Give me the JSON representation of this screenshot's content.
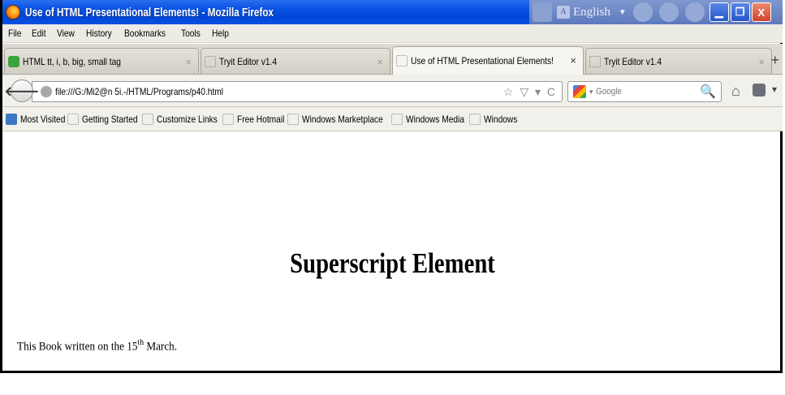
{
  "window": {
    "title": "Use of HTML Presentational Elements! - Mozilla Firefox",
    "language": "English",
    "controls": [
      "minimize",
      "restore",
      "close"
    ]
  },
  "menu": [
    "File",
    "Edit",
    "View",
    "History",
    "Bookmarks",
    "Tools",
    "Help"
  ],
  "tabs": [
    {
      "label": "HTML tt, i, b, big, small tag",
      "active": false
    },
    {
      "label": "Tryit Editor v1.4",
      "active": false
    },
    {
      "label": "Use of HTML Presentational Elements!",
      "active": true
    },
    {
      "label": "Tryit Editor v1.4",
      "active": false
    }
  ],
  "tab_close_glyph": "×",
  "new_tab_glyph": "+",
  "nav": {
    "url": "file:///G:/Mi2@n 5i.-/HTML/Programs/p40.html",
    "search_placeholder": "Google"
  },
  "bookmarks": [
    "Most Visited",
    "Getting Started",
    "Customize Links",
    "Free Hotmail",
    "Windows Marketplace",
    "Windows Media",
    "Windows"
  ],
  "page": {
    "heading": "Superscript Element",
    "text_before": "This Book written on the 15",
    "superscript": "th",
    "text_after": " March."
  }
}
